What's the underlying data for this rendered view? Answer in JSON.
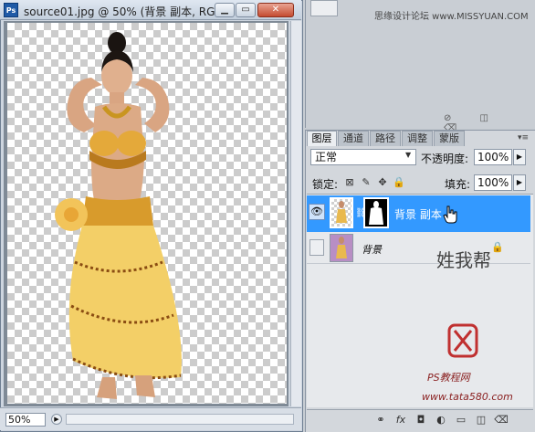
{
  "document": {
    "title": "source01.jpg @ 50% (背景 副本, RG...",
    "app_icon": "Ps",
    "zoom": "50%",
    "buttons": {
      "minimize": "▁",
      "maximize": "▭",
      "close": "✕"
    }
  },
  "top_panel": {
    "site_text": "思缘设计论坛  www.MISSYUAN.COM"
  },
  "layers_panel": {
    "tabs": [
      "图层",
      "通道",
      "路径",
      "调整",
      "蒙版"
    ],
    "active_tab": 0,
    "blend_mode": "正常",
    "opacity_label": "不透明度:",
    "opacity_value": "100%",
    "lock_label": "锁定:",
    "fill_label": "填充:",
    "fill_value": "100%",
    "layers": [
      {
        "name": "背景 副本",
        "visible": true,
        "selected": true,
        "has_mask": true
      },
      {
        "name": "背景",
        "visible": false,
        "selected": false,
        "locked": true
      }
    ],
    "bottom_icons": [
      "link-icon",
      "fx-icon",
      "mask-icon",
      "adjustment-icon",
      "group-icon",
      "new-layer-icon",
      "trash-icon"
    ]
  },
  "watermark": {
    "calligraphy": "他姓我帮你",
    "site": "PS教程网",
    "url": "www.tata580.com"
  },
  "colors": {
    "selection": "#3399ff",
    "panel_bg": "#d3d7dc",
    "titlebar": "#c3cfdd"
  }
}
